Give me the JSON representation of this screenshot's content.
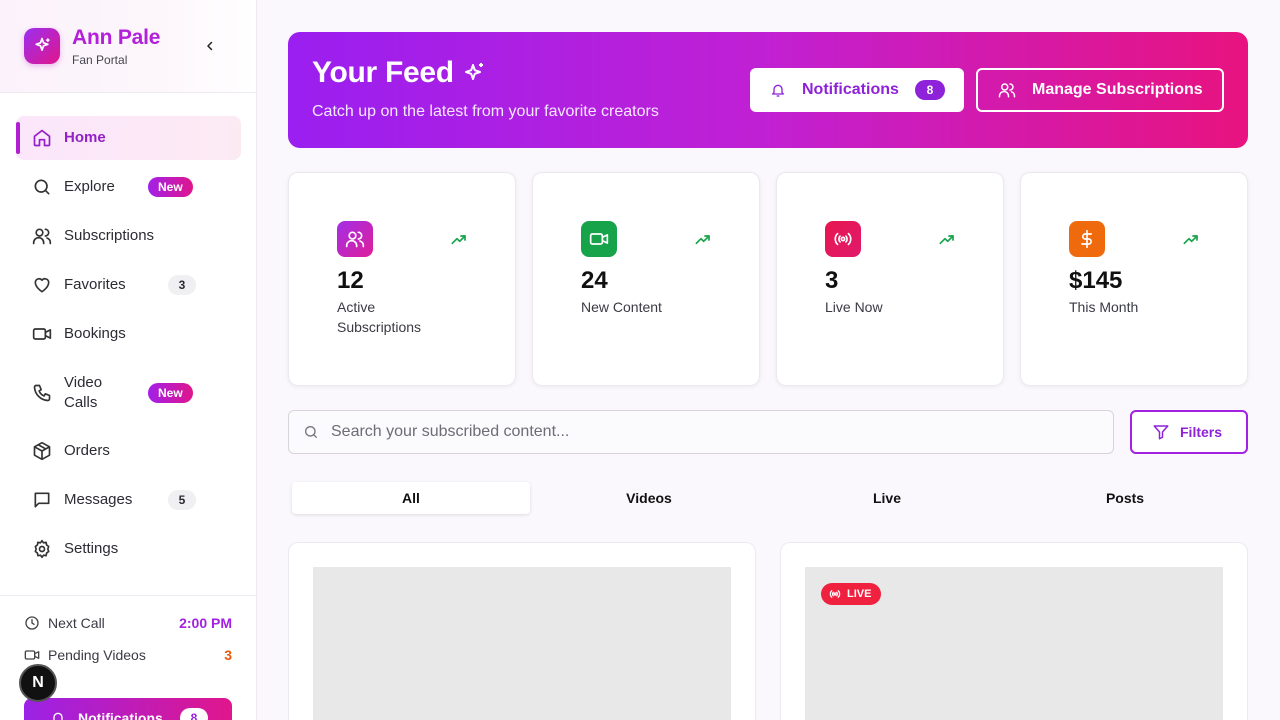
{
  "brand": {
    "name": "Ann Pale",
    "subtitle": "Fan Portal"
  },
  "sidebar": {
    "items": [
      {
        "label": "Home",
        "icon": "home-icon",
        "active": true
      },
      {
        "label": "Explore",
        "icon": "search-icon",
        "badge": "New"
      },
      {
        "label": "Subscriptions",
        "icon": "users-icon"
      },
      {
        "label": "Favorites",
        "icon": "heart-icon",
        "count": "3"
      },
      {
        "label": "Bookings",
        "icon": "video-icon"
      },
      {
        "label": "Video Calls",
        "icon": "phone-icon",
        "badge": "New"
      },
      {
        "label": "Orders",
        "icon": "package-icon"
      },
      {
        "label": "Messages",
        "icon": "message-icon",
        "count": "5"
      },
      {
        "label": "Settings",
        "icon": "gear-icon"
      }
    ],
    "footer": {
      "next_call_label": "Next Call",
      "next_call_value": "2:00 PM",
      "pending_label": "Pending Videos",
      "pending_value": "3",
      "notifications_label": "Notifications",
      "notifications_count": "8"
    }
  },
  "hero": {
    "title": "Your Feed",
    "subtitle": "Catch up on the latest from your favorite creators",
    "notifications_label": "Notifications",
    "notifications_count": "8",
    "manage_label": "Manage Subscriptions"
  },
  "stats": [
    {
      "value": "12",
      "label": "Active Subscriptions",
      "color": "#b52ee0",
      "icon": "users-icon"
    },
    {
      "value": "24",
      "label": "New Content",
      "color": "#17a34a",
      "icon": "video-icon"
    },
    {
      "value": "3",
      "label": "Live Now",
      "color": "#e8164f",
      "icon": "broadcast-icon"
    },
    {
      "value": "$145",
      "label": "This Month",
      "color": "#ef6a0c",
      "icon": "dollar-icon"
    }
  ],
  "search": {
    "placeholder": "Search your subscribed content..."
  },
  "filters_label": "Filters",
  "tabs": [
    "All",
    "Videos",
    "Live",
    "Posts"
  ],
  "posts": [
    {
      "live": false
    },
    {
      "live": true,
      "live_label": "LIVE"
    }
  ],
  "next_badge_label": "N",
  "colors": {
    "accent": "#a321e0",
    "pink": "#e0168c",
    "trend": "#16a34a",
    "live": "#f0213e"
  }
}
